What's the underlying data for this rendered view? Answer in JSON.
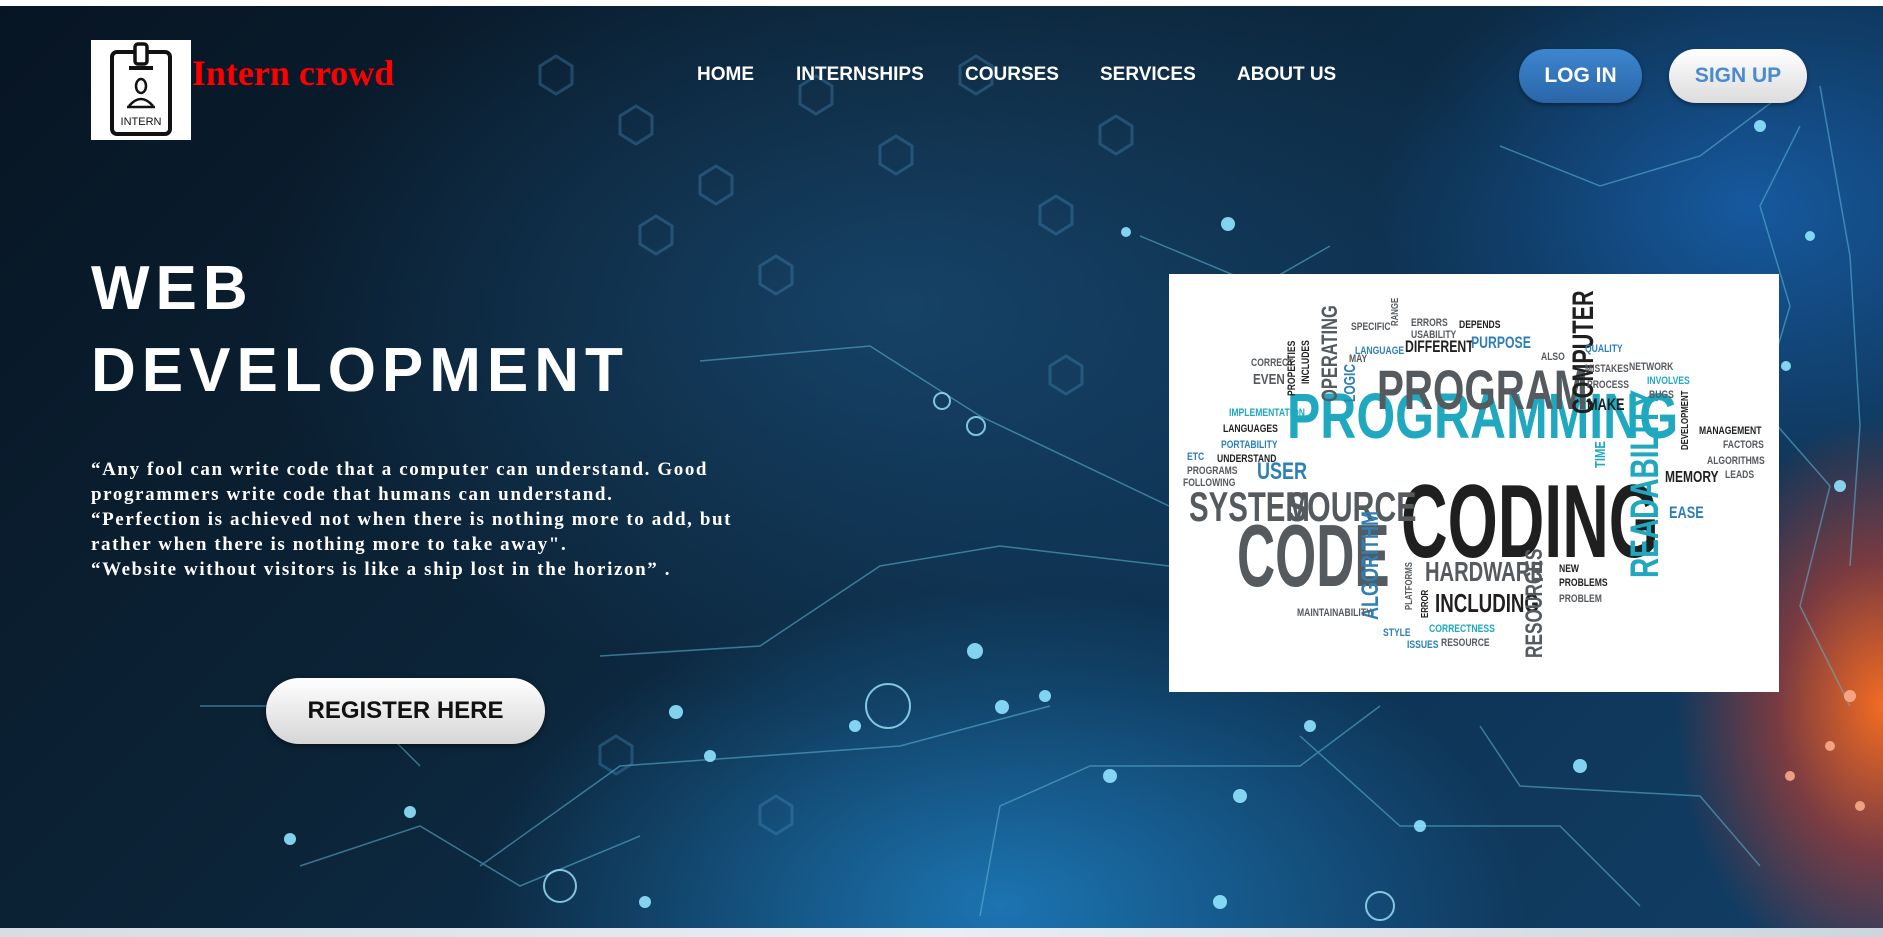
{
  "brand": {
    "name": "Intern crowd",
    "logo_text": "INTERN",
    "name_color": "#ff0000"
  },
  "nav": {
    "items": [
      "HOME",
      "INTERNSHIPS",
      "COURSES",
      "SERVICES",
      "ABOUT US"
    ]
  },
  "auth": {
    "login_label": "LOG IN",
    "signup_label": "SIGN UP"
  },
  "hero": {
    "title_line1": "WEB",
    "title_line2": "DEVELOPMENT",
    "quote_lines": [
      "“Any fool can write code that a computer can understand. Good",
      "programmers write code that humans can understand.",
      "“Perfection is achieved not when there is nothing more to add, but",
      "rather when there is nothing more to take away\".",
      "“Website without visitors is like a ship lost in the horizon” ."
    ],
    "register_label": "REGISTER HERE"
  },
  "word_cloud": {
    "words": [
      "PROGRAMMING",
      "CODING",
      "CODE",
      "PROGRAM",
      "SYSTEM",
      "SOURCE",
      "READABILITY",
      "COMPUTER",
      "OPERATING",
      "ALGORITHM",
      "HARDWARE",
      "INCLUDING",
      "RESOURCES",
      "USER",
      "LOGIC",
      "DIFFERENT",
      "PURPOSE",
      "MEMORY",
      "EASE",
      "MAKE",
      "TIME",
      "LANGUAGES",
      "LANGUAGE",
      "PORTABILITY",
      "IMPLEMENTATION",
      "MAINTAINABILITY",
      "CORRECTNESS",
      "ISSUES",
      "STYLE",
      "RESOURCE",
      "PROBLEMS",
      "PROBLEM",
      "NEW",
      "ERRORS",
      "USABILITY",
      "DEPENDS",
      "SPECIFIC",
      "RANGE",
      "QUALITY",
      "MISTAKES",
      "NETWORK",
      "INVOLVES",
      "PROCESS",
      "BUGS",
      "DEVELOPMENT",
      "MANAGEMENT",
      "FACTORS",
      "ALGORITHMS",
      "LEADS",
      "CORRECT",
      "EVEN",
      "PROPERTIES",
      "INCLUDES",
      "MAY",
      "UNDERSTAND",
      "ETC",
      "PROGRAMS",
      "FOLLOWING",
      "ALSO",
      "ERROR",
      "PLATFORMS"
    ]
  }
}
